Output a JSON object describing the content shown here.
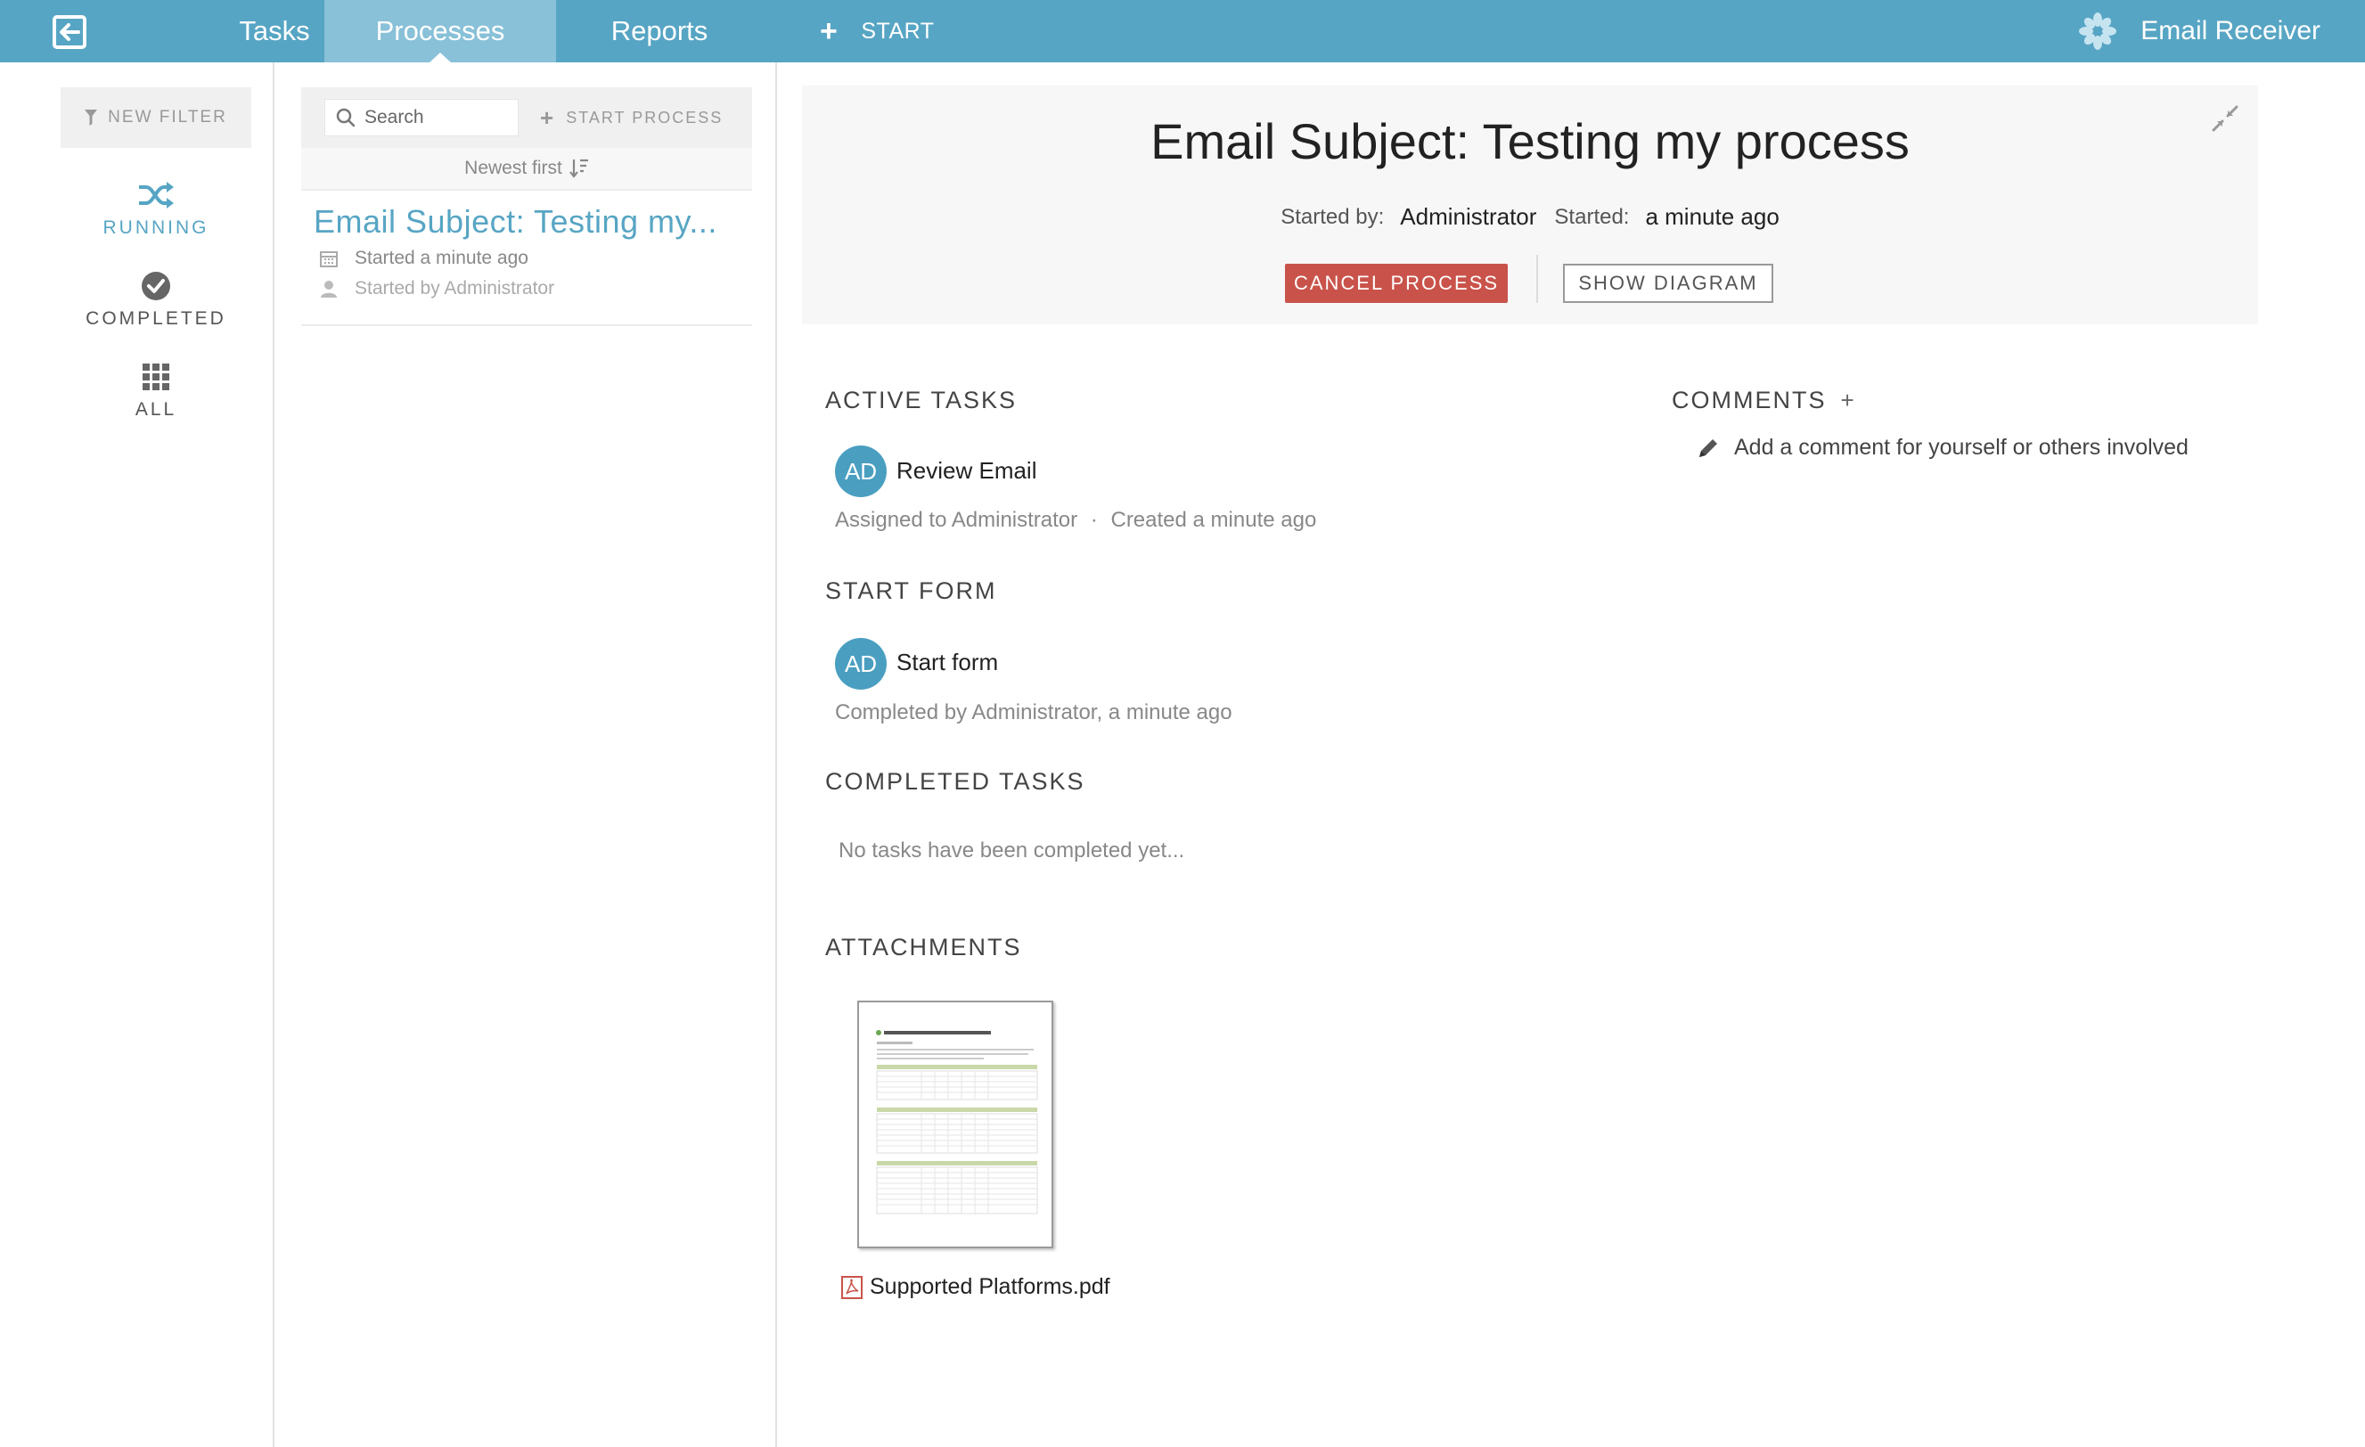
{
  "nav": {
    "tabs": [
      {
        "label": "Tasks"
      },
      {
        "label": "Processes",
        "active": true
      },
      {
        "label": "Reports"
      }
    ],
    "start_label": "START",
    "app_name": "Email Receiver",
    "accent": "#57a5c4"
  },
  "filters": {
    "new_filter": "NEW FILTER",
    "items": [
      {
        "label": "RUNNING",
        "icon": "shuffle-icon",
        "active": true
      },
      {
        "label": "COMPLETED",
        "icon": "check-circle-icon"
      },
      {
        "label": "ALL",
        "icon": "grid-icon"
      }
    ]
  },
  "list": {
    "search_placeholder": "Search",
    "start_process": "START PROCESS",
    "sort_label": "Newest first",
    "items": [
      {
        "title": "Email Subject: Testing my...",
        "started": "Started a minute ago",
        "started_by": "Started by Administrator"
      }
    ]
  },
  "detail": {
    "title": "Email Subject: Testing my process",
    "started_by_label": "Started by:",
    "started_by_value": "Administrator",
    "started_label": "Started:",
    "started_value": "a minute ago",
    "cancel_label": "CANCEL PROCESS",
    "diagram_label": "SHOW DIAGRAM",
    "cancel_color": "#c9534a",
    "active_tasks": {
      "title": "ACTIVE TASKS",
      "items": [
        {
          "initials": "AD",
          "name": "Review Email",
          "assigned": "Assigned to Administrator",
          "separator": "·",
          "created": "Created a minute ago"
        }
      ]
    },
    "start_form": {
      "title": "START FORM",
      "initials": "AD",
      "name": "Start form",
      "completed": "Completed by Administrator, a minute ago"
    },
    "completed_tasks": {
      "title": "COMPLETED TASKS",
      "empty": "No tasks have been completed yet..."
    },
    "attachments": {
      "title": "ATTACHMENTS",
      "items": [
        {
          "file_name": "Supported Platforms.pdf"
        }
      ]
    },
    "comments": {
      "title": "COMMENTS",
      "add": "+",
      "prompt": "Add a comment for yourself or others involved"
    }
  }
}
